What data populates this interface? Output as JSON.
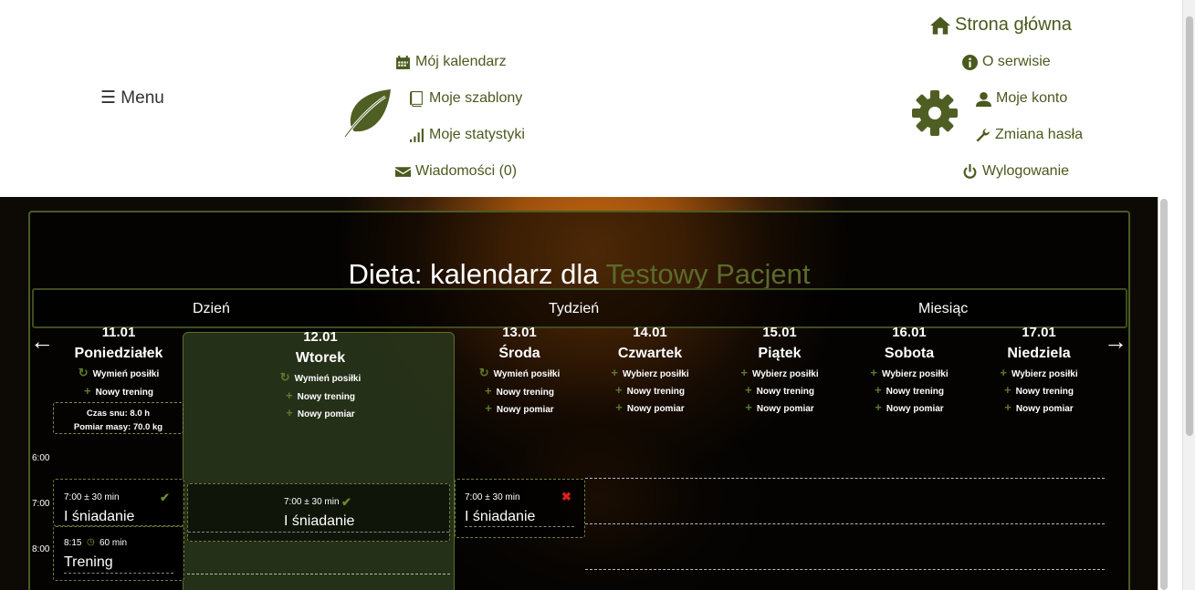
{
  "header": {
    "menu_label": "☰ Menu",
    "nav_left": [
      {
        "label": "Mój kalendarz",
        "icon": "calendar-icon"
      },
      {
        "label": "Moje szablony",
        "icon": "book-icon"
      },
      {
        "label": "Moje statystyki",
        "icon": "signal-icon"
      },
      {
        "label": "Wiadomości (0)",
        "icon": "envelope-icon"
      }
    ],
    "nav_right": [
      {
        "label": "Strona główna",
        "icon": "home-icon"
      },
      {
        "label": "O serwisie",
        "icon": "info-icon"
      },
      {
        "label": "Moje konto",
        "icon": "user-icon"
      },
      {
        "label": "Zmiana hasła",
        "icon": "wrench-icon"
      },
      {
        "label": "Wylogowanie",
        "icon": "power-icon"
      }
    ],
    "logo_icon": "leaf-icon",
    "settings_icon": "gear-icon",
    "brand_color": "#4a5a1e"
  },
  "calendar": {
    "title_prefix": "Dieta: kalendarz dla",
    "patient": "Testowy Pacjent",
    "views": [
      "Dzień",
      "Tydzień",
      "Miesiąc"
    ],
    "prev_arrow": "←",
    "next_arrow": "→",
    "days": [
      {
        "date": "11.01",
        "name": "Poniedziałek",
        "actions": [
          "Wymień posiłki",
          "Nowy trening"
        ]
      },
      {
        "date": "12.01",
        "name": "Wtorek",
        "actions": [
          "Wymień posiłki",
          "Nowy trening",
          "Nowy pomiar"
        ]
      },
      {
        "date": "13.01",
        "name": "Środa",
        "actions": [
          "Wymień posiłki",
          "Nowy trening",
          "Nowy pomiar"
        ]
      },
      {
        "date": "14.01",
        "name": "Czwartek",
        "actions": [
          "Wybierz posiłki",
          "Nowy trening",
          "Nowy pomiar"
        ]
      },
      {
        "date": "15.01",
        "name": "Piątek",
        "actions": [
          "Wybierz posiłki",
          "Nowy trening",
          "Nowy pomiar"
        ]
      },
      {
        "date": "16.01",
        "name": "Sobota",
        "actions": [
          "Wybierz posiłki",
          "Nowy trening",
          "Nowy pomiar"
        ]
      },
      {
        "date": "17.01",
        "name": "Niedziela",
        "actions": [
          "Wybierz posiłki",
          "Nowy trening",
          "Nowy pomiar"
        ]
      }
    ],
    "stats": {
      "sleep": "Czas snu: 8.0 h",
      "weight": "Pomiar masy: 70.0 kg"
    },
    "hours": [
      "6:00",
      "7:00",
      "8:00"
    ],
    "events": {
      "mon_breakfast": {
        "time": "7:00 ± 30 min",
        "title": "I śniadanie",
        "status": "done"
      },
      "mon_training": {
        "time": "8:15",
        "duration": "60 min",
        "title": "Trening"
      },
      "tue_breakfast": {
        "time": "7:00 ± 30 min",
        "title": "I śniadanie",
        "status": "done"
      },
      "wed_breakfast": {
        "time": "7:00 ± 30 min",
        "title": "I śniadanie",
        "status": "missed"
      }
    },
    "today_highlight_color": "#2c381c"
  }
}
